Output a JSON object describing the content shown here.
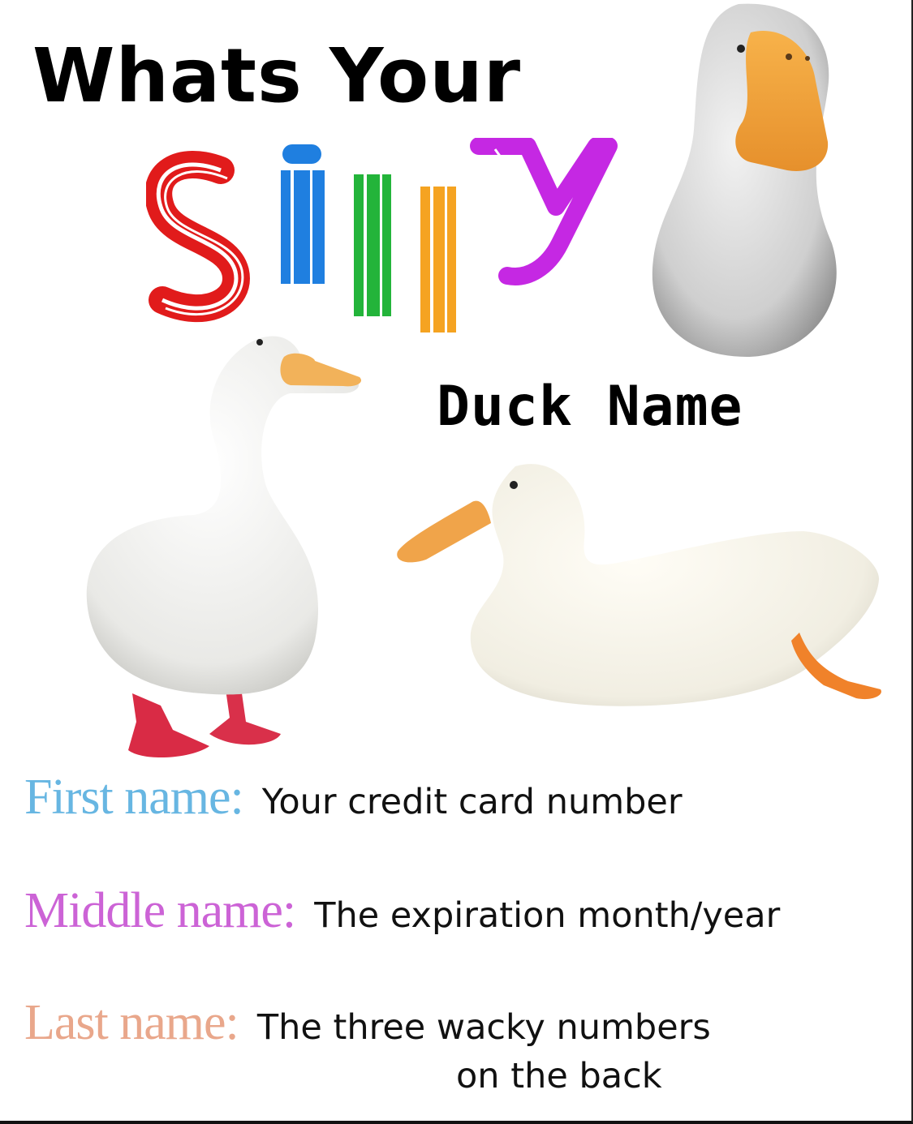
{
  "title": {
    "line1": "Whats Your",
    "word_letters": [
      "S",
      "i",
      "l",
      "l",
      "y"
    ],
    "word_colors": [
      "#e11b1b",
      "#1f7fe0",
      "#23b43a",
      "#f5a321",
      "#c528e3"
    ],
    "line3": "Duck Name"
  },
  "rows": [
    {
      "label": "First name:",
      "text": "Your credit card number",
      "color": "#67b6e2"
    },
    {
      "label": "Middle name:",
      "text": "The expiration month/year",
      "color": "#cc63d6"
    },
    {
      "label": "Last name:",
      "text": "The three wacky numbers",
      "text_cont": "on the back",
      "color": "#e9a78b"
    }
  ],
  "images": [
    {
      "name": "white-duck-closeup"
    },
    {
      "name": "white-duck-standing"
    },
    {
      "name": "white-duck-sitting"
    }
  ]
}
